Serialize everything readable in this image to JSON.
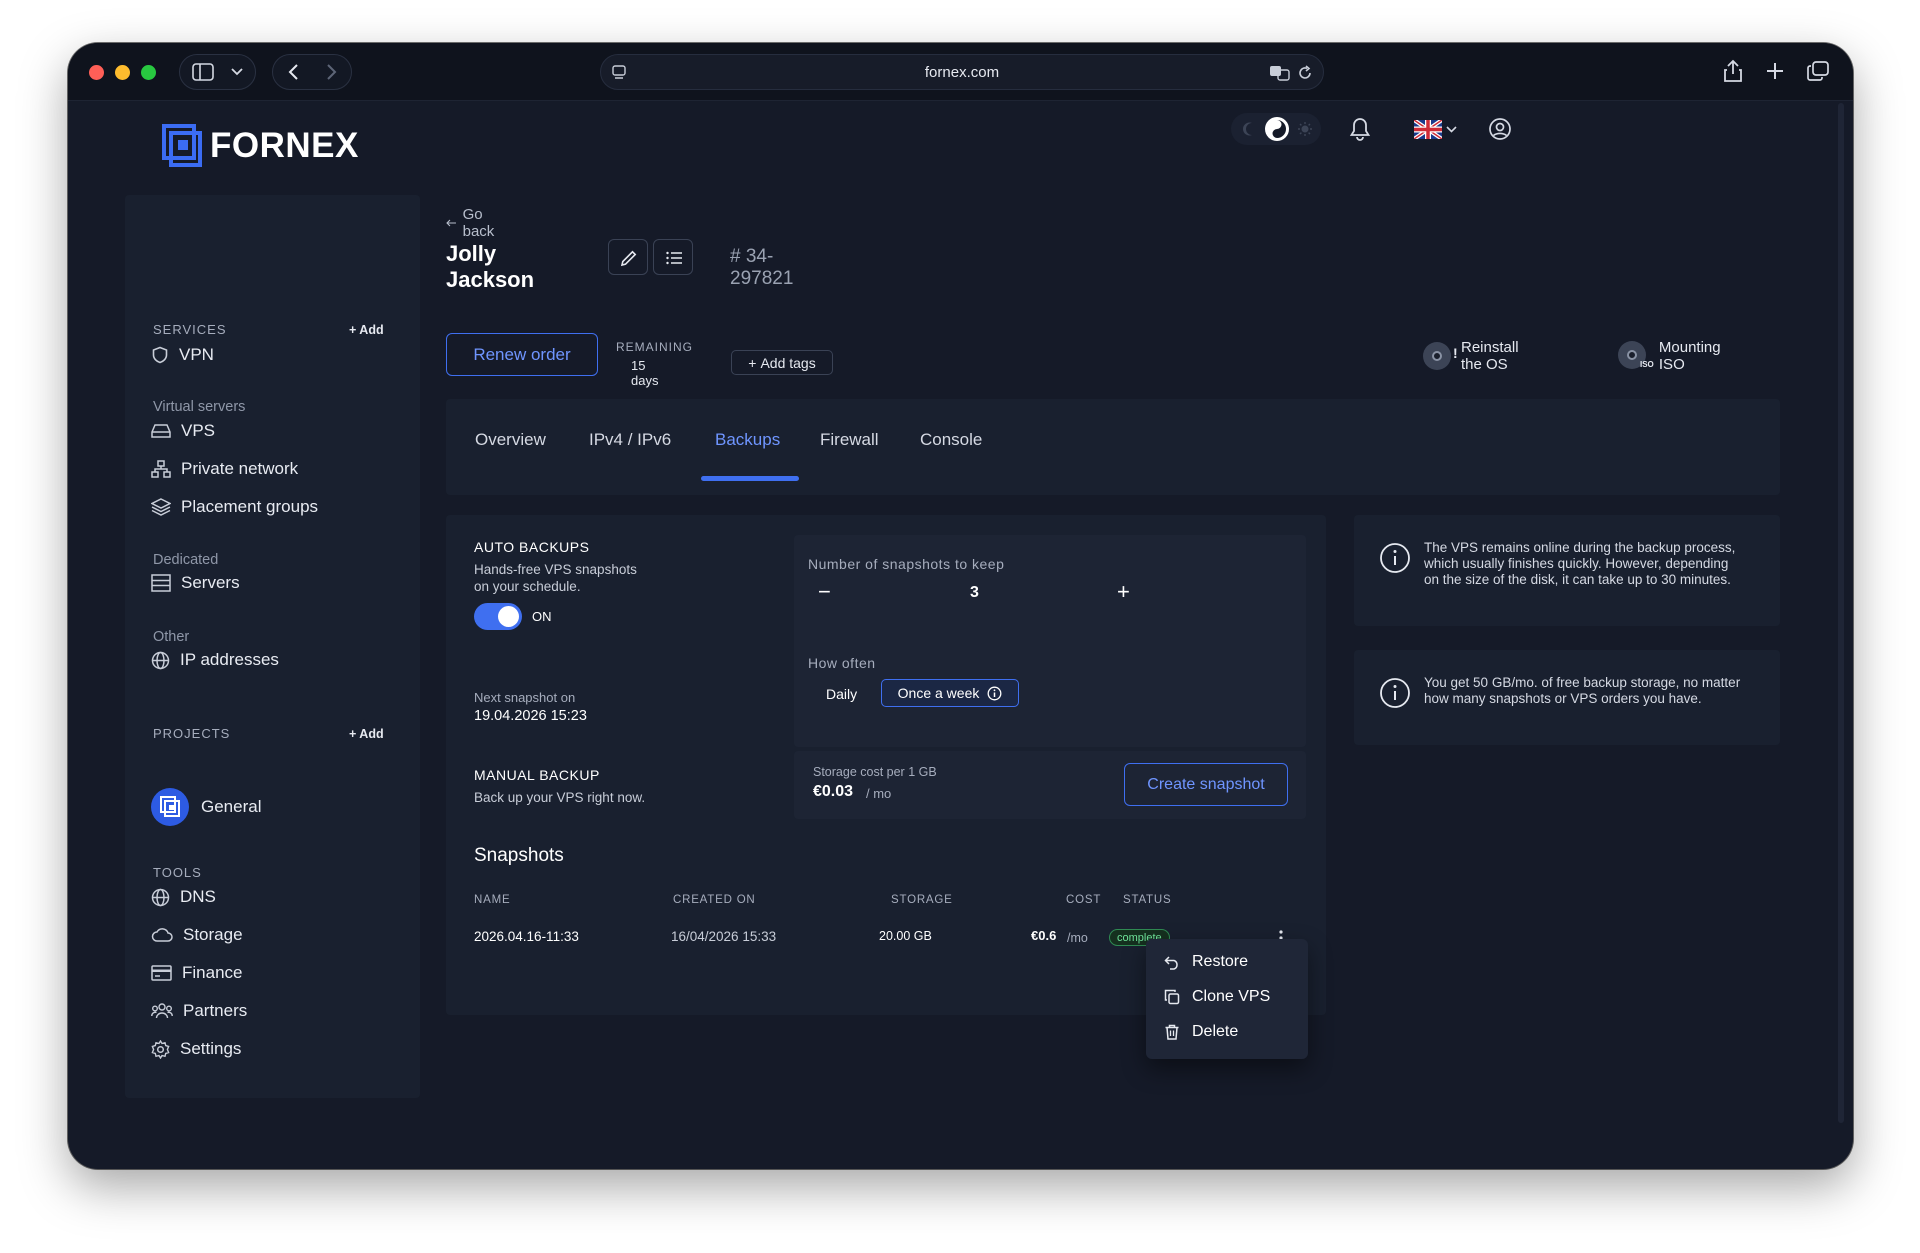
{
  "browser": {
    "url": "fornex.com"
  },
  "logo": {
    "text": "FORNEX"
  },
  "sidebar": {
    "services_label": "SERVICES",
    "add_label": "+ Add",
    "vpn": "VPN",
    "virtual_servers_label": "Virtual servers",
    "vps": "VPS",
    "private_network": "Private network",
    "placement_groups": "Placement groups",
    "dedicated_label": "Dedicated",
    "servers": "Servers",
    "other_label": "Other",
    "ip_addresses": "IP addresses",
    "projects_label": "PROJECTS",
    "projects_add": "+ Add",
    "project_general": "General",
    "tools_label": "TOOLS",
    "dns": "DNS",
    "storage": "Storage",
    "finance": "Finance",
    "partners": "Partners",
    "settings": "Settings"
  },
  "header": {
    "go_back": "Go back",
    "title": "Jolly Jackson",
    "order_id": "# 34-297821",
    "renew": "Renew order",
    "remaining_label": "REMAINING",
    "remaining_value": "15 days",
    "add_tags": "Add tags",
    "reinstall": "Reinstall the OS",
    "mounting_iso": "Mounting ISO",
    "iso_badge": "ISO"
  },
  "tabs": [
    "Overview",
    "IPv4 / IPv6",
    "Backups",
    "Firewall",
    "Console"
  ],
  "backups": {
    "auto_title": "AUTO BACKUPS",
    "auto_desc_1": "Hands-free VPS snapshots",
    "auto_desc_2": "on your schedule.",
    "toggle_state": "ON",
    "next_label": "Next snapshot on",
    "next_value": "19.04.2026 15:23",
    "keep_label": "Number of snapshots to keep",
    "keep_minus": "−",
    "keep_value": "3",
    "keep_plus": "+",
    "often_label": "How often",
    "often_daily": "Daily",
    "often_week": "Once a week",
    "manual_title": "MANUAL BACKUP",
    "manual_desc": "Back up your VPS right now.",
    "cost_label": "Storage cost per 1 GB",
    "cost_value": "€0.03",
    "cost_unit": "/ mo",
    "create": "Create snapshot"
  },
  "snapshots": {
    "title": "Snapshots",
    "headers": [
      "NAME",
      "CREATED ON",
      "STORAGE",
      "COST",
      "STATUS"
    ],
    "rows": [
      {
        "name": "2026.04.16-11:33",
        "created": "16/04/2026 15:33",
        "storage": "20.00 GB",
        "cost": "€0.6",
        "cost_unit": "/mo",
        "status": "complete"
      }
    ]
  },
  "context_menu": [
    "Restore",
    "Clone VPS",
    "Delete"
  ],
  "info": {
    "card1": "The VPS remains online during the backup process, which usually finishes quickly. However, depending on the size of the disk, it can take up to 30 minutes.",
    "card2": "You get 50 GB/mo. of free backup storage, no matter how many snapshots or VPS orders you have."
  },
  "colors": {
    "accent": "#3f6ff0",
    "background": "#151a28",
    "panel": "#19202f",
    "status_green": "#6ee39a"
  }
}
